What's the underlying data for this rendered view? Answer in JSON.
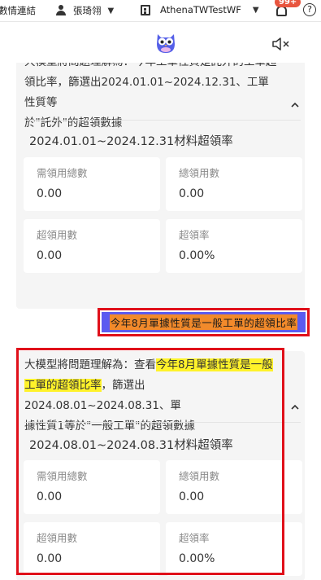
{
  "topbar": {
    "left_link": "數情連結",
    "user_name": "張琦翎",
    "tenant": "AthenaTWTestWF",
    "notification_badge": "99+",
    "help": "?"
  },
  "colors": {
    "user_bubble": "#5b5bf0",
    "user_text_highlight": "#f28a2b",
    "answer_highlight": "#fff22a",
    "card_bg": "#f5f5f5",
    "annotation_red": "#e0101a"
  },
  "prev_answer": {
    "line1": "大模型將問題理解為：今年工單性質是託外的工單超",
    "line2": "領比率，篩選出2024.01.01~2024.12.31、工單性質等",
    "line3": "於\"託外\"的超領數據",
    "period_title": "2024.01.01~2024.12.31材料超領率",
    "stats": [
      {
        "label": "需領用總數",
        "value": "0.00"
      },
      {
        "label": "總領用數",
        "value": "0.00"
      },
      {
        "label": "超領用數",
        "value": "0.00"
      },
      {
        "label": "超領率",
        "value": "0.00%"
      }
    ]
  },
  "user_message": "今年8月單據性質是一般工單的超領比率",
  "answer": {
    "prefix": "大模型將問題理解為：查看",
    "hl1": "今年8月單據性質是一般",
    "hl2": "工單的超領比率",
    "mid": "，篩選出2024.08.01~2024.08.31、單",
    "line3": "據性質1等於\"一般工單\"的超領數據",
    "period_title": "2024.08.01~2024.08.31材料超領率",
    "stats": [
      {
        "label": "需領用總數",
        "value": "0.00"
      },
      {
        "label": "總領用數",
        "value": "0.00"
      },
      {
        "label": "超領用數",
        "value": "0.00"
      },
      {
        "label": "超領率",
        "value": "0.00%"
      }
    ]
  }
}
